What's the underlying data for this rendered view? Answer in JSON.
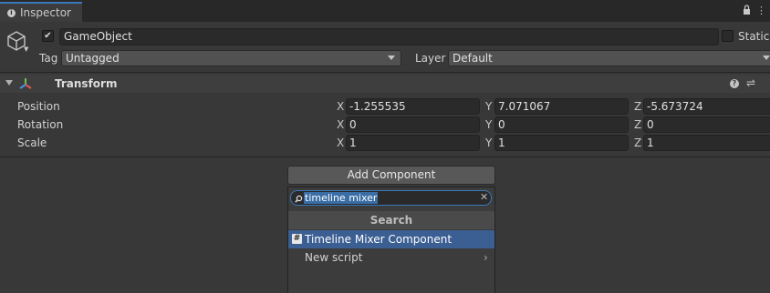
{
  "tab": {
    "title": "Inspector"
  },
  "header": {
    "name": "GameObject",
    "static_label": "Static",
    "tag_label": "Tag",
    "tag_value": "Untagged",
    "layer_label": "Layer",
    "layer_value": "Default"
  },
  "transform": {
    "title": "Transform",
    "rows": [
      {
        "label": "Position",
        "x": "-1.255535",
        "y": "7.071067",
        "z": "-5.673724"
      },
      {
        "label": "Rotation",
        "x": "0",
        "y": "0",
        "z": "0"
      },
      {
        "label": "Scale",
        "x": "1",
        "y": "1",
        "z": "1"
      }
    ],
    "axis": {
      "x": "X",
      "y": "Y",
      "z": "Z"
    }
  },
  "add_component": {
    "button_label": "Add Component",
    "search_value": "timeline mixer",
    "section_header": "Search",
    "items": [
      {
        "label": "Timeline Mixer Component",
        "icon": "#"
      },
      {
        "label": "New script"
      }
    ]
  },
  "colors": {
    "accent": "#3a79bb",
    "selection": "#3b5e93",
    "background": "#383838"
  }
}
